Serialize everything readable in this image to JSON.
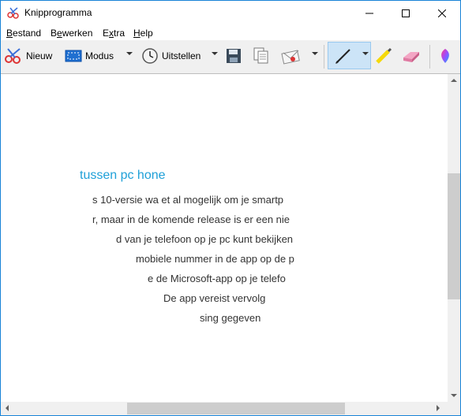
{
  "window": {
    "title": "Knipprogramma"
  },
  "menu": [
    {
      "label": "Bestand",
      "mnemonic": "B",
      "rest": "estand"
    },
    {
      "label": "Bewerken",
      "mnemonic": "e",
      "pre": "B",
      "rest": "werken"
    },
    {
      "label": "Extra",
      "mnemonic": "x",
      "pre": "E",
      "rest": "tra"
    },
    {
      "label": "Help",
      "mnemonic": "H",
      "rest": "elp"
    }
  ],
  "toolbar": {
    "new_label": "Nieuw",
    "mode_label": "Modus",
    "delay_label": "Uitstellen"
  },
  "snip": {
    "heading": "tussen pc          hone",
    "lines": [
      "s 10-versie wa   et al mogelijk om je smartp",
      "r, maar in de komende release is er een nie",
      "d van je telefoon op je pc kunt bekijken",
      "mobiele nummer in de app op de p",
      "e de Microsoft-app op je telefo",
      "De app vereist vervolg",
      "sing gegeven"
    ]
  },
  "colors": {
    "accent": "#1fa0d8",
    "active_tool": "#cce4f7",
    "border": "#1883d7"
  }
}
